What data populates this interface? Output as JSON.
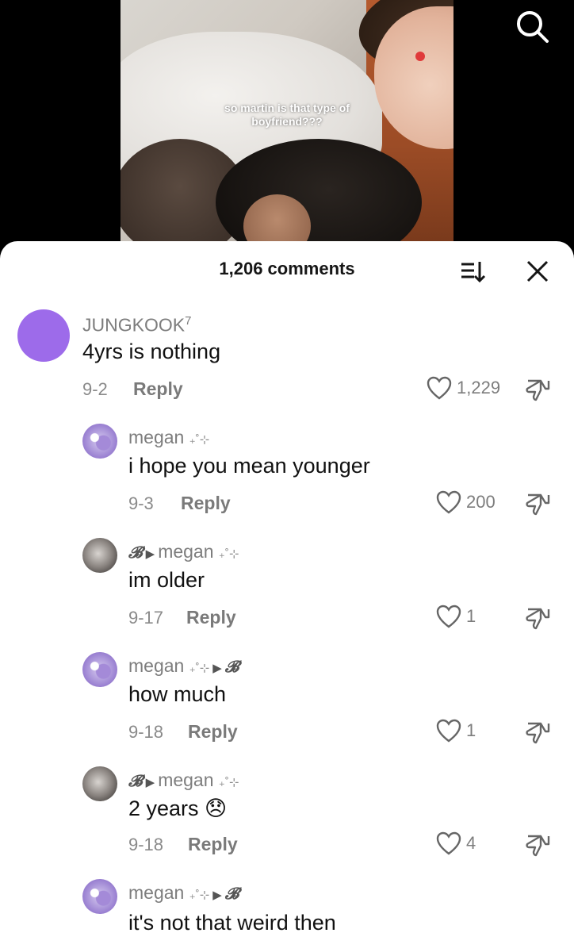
{
  "video": {
    "caption_line1": "so martin is that type of",
    "caption_line2": "boyfriend???"
  },
  "sheet": {
    "comment_count": "1,206 comments"
  },
  "comments": [
    {
      "user": "JUNGKOOK",
      "user_sup": "7",
      "text": "4yrs is nothing",
      "date": "9-2",
      "reply": "Reply",
      "likes": "1,229"
    },
    {
      "user": "megan",
      "user_deco": "₊˚⊹",
      "text": "i hope you mean younger",
      "date": "9-3",
      "reply": "Reply",
      "likes": "200"
    },
    {
      "user": "𝓑",
      "reply_to": "megan",
      "reply_to_deco": "₊˚⊹",
      "text": "im older",
      "date": "9-17",
      "reply": "Reply",
      "likes": "1"
    },
    {
      "user": "megan",
      "user_deco": "₊˚⊹",
      "reply_to": "𝓑",
      "text": "how much",
      "date": "9-18",
      "reply": "Reply",
      "likes": "1"
    },
    {
      "user": "𝓑",
      "reply_to": "megan",
      "reply_to_deco": "₊˚⊹",
      "text": "2 years 😞",
      "date": "9-18",
      "reply": "Reply",
      "likes": "4"
    },
    {
      "user": "megan",
      "user_deco": "₊˚⊹",
      "reply_to": "𝓑",
      "text": "it's not that weird then",
      "date": "",
      "reply": "",
      "likes": ""
    }
  ],
  "icons": {
    "search": "search-icon",
    "sort": "sort-icon",
    "close": "close-icon",
    "like": "heart-icon",
    "dislike": "thumbs-down-icon"
  }
}
